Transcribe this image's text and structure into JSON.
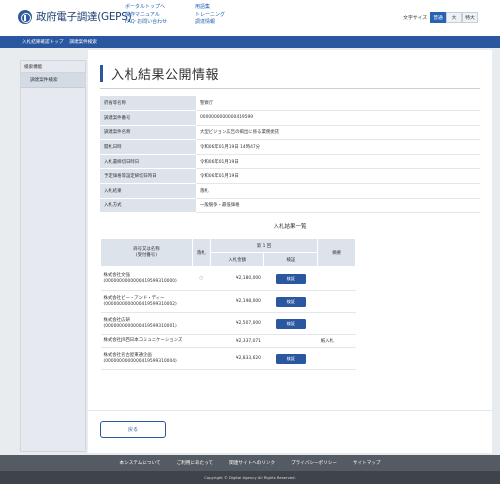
{
  "header": {
    "logo_text": "政府電子調達(GEPS)",
    "links_col1": [
      "ポータルトップへ",
      "操作マニュアル",
      "FAQ･お問い合わせ"
    ],
    "links_col2": [
      "用語集",
      "トレーニング",
      "調達情報"
    ],
    "font_size_label": "文字サイズ",
    "font_sizes": [
      "普通",
      "大",
      "特大"
    ],
    "active_font_size": "普通"
  },
  "breadcrumb": [
    "入札結果確認トップ",
    "調達案件検索"
  ],
  "sidebar": {
    "heading": "検索機能",
    "items": [
      "調達案件検索"
    ]
  },
  "main": {
    "title": "入札結果公開情報",
    "info": [
      {
        "label": "府省等名称",
        "value": "警察庁"
      },
      {
        "label": "調達案件番号",
        "value": "0000000000000419599"
      },
      {
        "label": "調達案件名称",
        "value": "大型ビジョン広告の掲出に係る業務委託"
      },
      {
        "label": "開札日時",
        "value": "令和06年01月19日 14時47分"
      },
      {
        "label": "入札書締切日時日",
        "value": "令和06年01月19日"
      },
      {
        "label": "予定価格等設定締切日時日",
        "value": "令和06年01月19日"
      },
      {
        "label": "入札結果",
        "value": "落札"
      },
      {
        "label": "入札方式",
        "value": "一般競争・最低価格"
      }
    ],
    "results_title": "入札結果一覧",
    "results_headers": {
      "company": "商号又は名称\n(受付番号)",
      "winner": "落札",
      "round": "第 1 回",
      "amount": "入札金額",
      "verify": "検証",
      "note": "摘要"
    },
    "verify_label": "検証",
    "results": [
      {
        "name": "株式会社文強",
        "number": "(0000000000000419599310000)",
        "winner": "○",
        "amount": "¥2,180,000",
        "verify": true,
        "note": ""
      },
      {
        "name": "株式会社ビー・アンド・ディー",
        "number": "(0000000000000419599310002)",
        "winner": "",
        "amount": "¥2,198,000",
        "verify": true,
        "note": ""
      },
      {
        "name": "株式会社広研",
        "number": "(0000000000000419599310001)",
        "winner": "",
        "amount": "¥2,507,000",
        "verify": true,
        "note": ""
      },
      {
        "name": "株式会社JR西日本コミュニケーションズ",
        "number": "",
        "winner": "",
        "amount": "¥2,337,071",
        "verify": false,
        "note": "紙入札"
      },
      {
        "name": "株式会社名古屋東通企画",
        "number": "(0000000000000419599310004)",
        "winner": "",
        "amount": "¥2,833,620",
        "verify": true,
        "note": ""
      }
    ],
    "back_label": "戻る"
  },
  "footer": {
    "links": [
      "本システムについて",
      "ご利用にあたって",
      "関連サイトへのリンク",
      "プライバシーポリシー",
      "サイトマップ"
    ],
    "copyright": "Copyright © Digital Agency All Rights Reserved."
  }
}
